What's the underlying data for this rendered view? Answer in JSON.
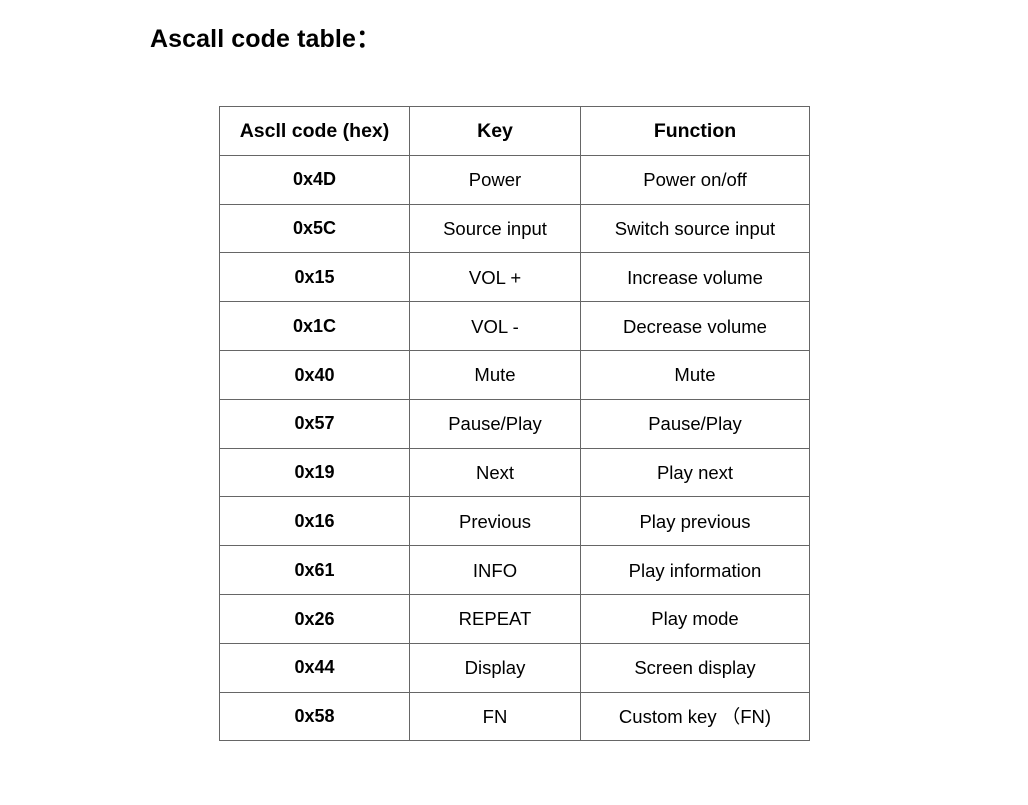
{
  "page": {
    "title": "Ascall code table：",
    "background_color": "#ffffff",
    "text_color": "#000000",
    "border_color": "#666666"
  },
  "table": {
    "headers": {
      "code": "Ascll code (hex)",
      "key": "Key",
      "function": "Function"
    },
    "rows": [
      {
        "code": "0x4D",
        "key": "Power",
        "function": "Power on/off"
      },
      {
        "code": "0x5C",
        "key": "Source input",
        "function": "Switch source input"
      },
      {
        "code": "0x15",
        "key": "VOL +",
        "function": "Increase volume"
      },
      {
        "code": "0x1C",
        "key": "VOL -",
        "function": "Decrease volume"
      },
      {
        "code": "0x40",
        "key": "Mute",
        "function": "Mute"
      },
      {
        "code": "0x57",
        "key": "Pause/Play",
        "function": "Pause/Play"
      },
      {
        "code": "0x19",
        "key": "Next",
        "function": "Play next"
      },
      {
        "code": "0x16",
        "key": "Previous",
        "function": "Play previous"
      },
      {
        "code": "0x61",
        "key": "INFO",
        "function": "Play information"
      },
      {
        "code": "0x26",
        "key": "REPEAT",
        "function": "Play mode"
      },
      {
        "code": "0x44",
        "key": "Display",
        "function": "Screen display"
      },
      {
        "code": "0x58",
        "key": "FN",
        "function": "Custom key （FN)"
      }
    ]
  }
}
